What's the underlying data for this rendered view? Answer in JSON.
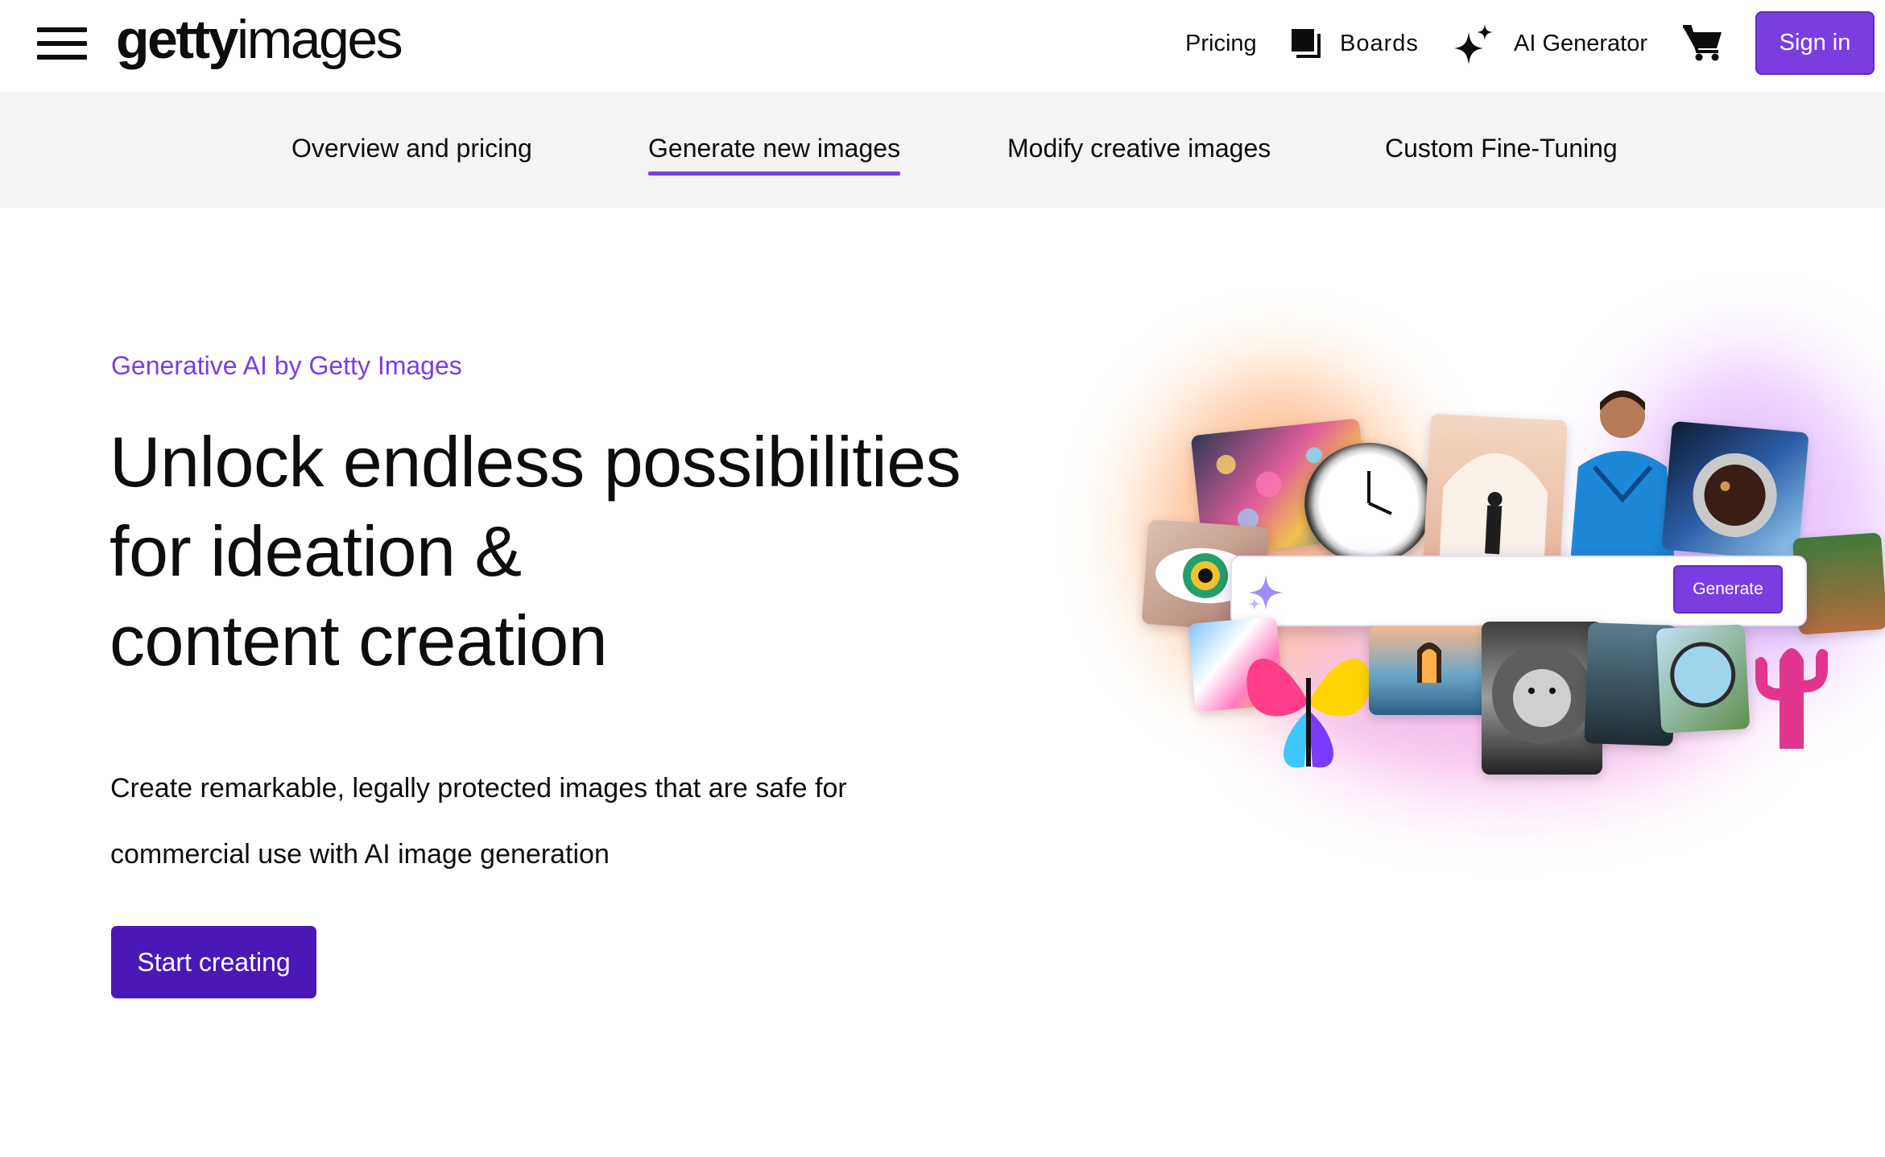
{
  "header": {
    "logo_bold": "getty",
    "logo_light": "images",
    "pricing_label": "Pricing",
    "boards_label": "Boards",
    "ai_generator_label": "AI Generator",
    "sign_in_label": "Sign in"
  },
  "subnav": {
    "tabs": [
      {
        "label": "Overview and pricing",
        "active": false
      },
      {
        "label": "Generate new images",
        "active": true
      },
      {
        "label": "Modify creative images",
        "active": false
      },
      {
        "label": "Custom Fine-Tuning",
        "active": false
      }
    ]
  },
  "hero": {
    "eyebrow": "Generative AI by Getty Images",
    "headline_lines": [
      "Unlock endless possibilities",
      "for ideation &",
      "content creation"
    ],
    "body_lines": [
      "Create remarkable, legally protected images that are safe for",
      "commercial use with AI image generation"
    ],
    "cta_label": "Start creating"
  },
  "collage": {
    "generate_label": "Generate"
  },
  "colors": {
    "accent": "#7a3ee0",
    "cta": "#4a18b7",
    "subnav_bg": "#f4f4f4",
    "text": "#0c0d0d"
  },
  "icons": {
    "menu": "hamburger-icon",
    "boards": "boards-icon",
    "ai_generator": "sparkle-icon",
    "cart": "cart-icon"
  }
}
